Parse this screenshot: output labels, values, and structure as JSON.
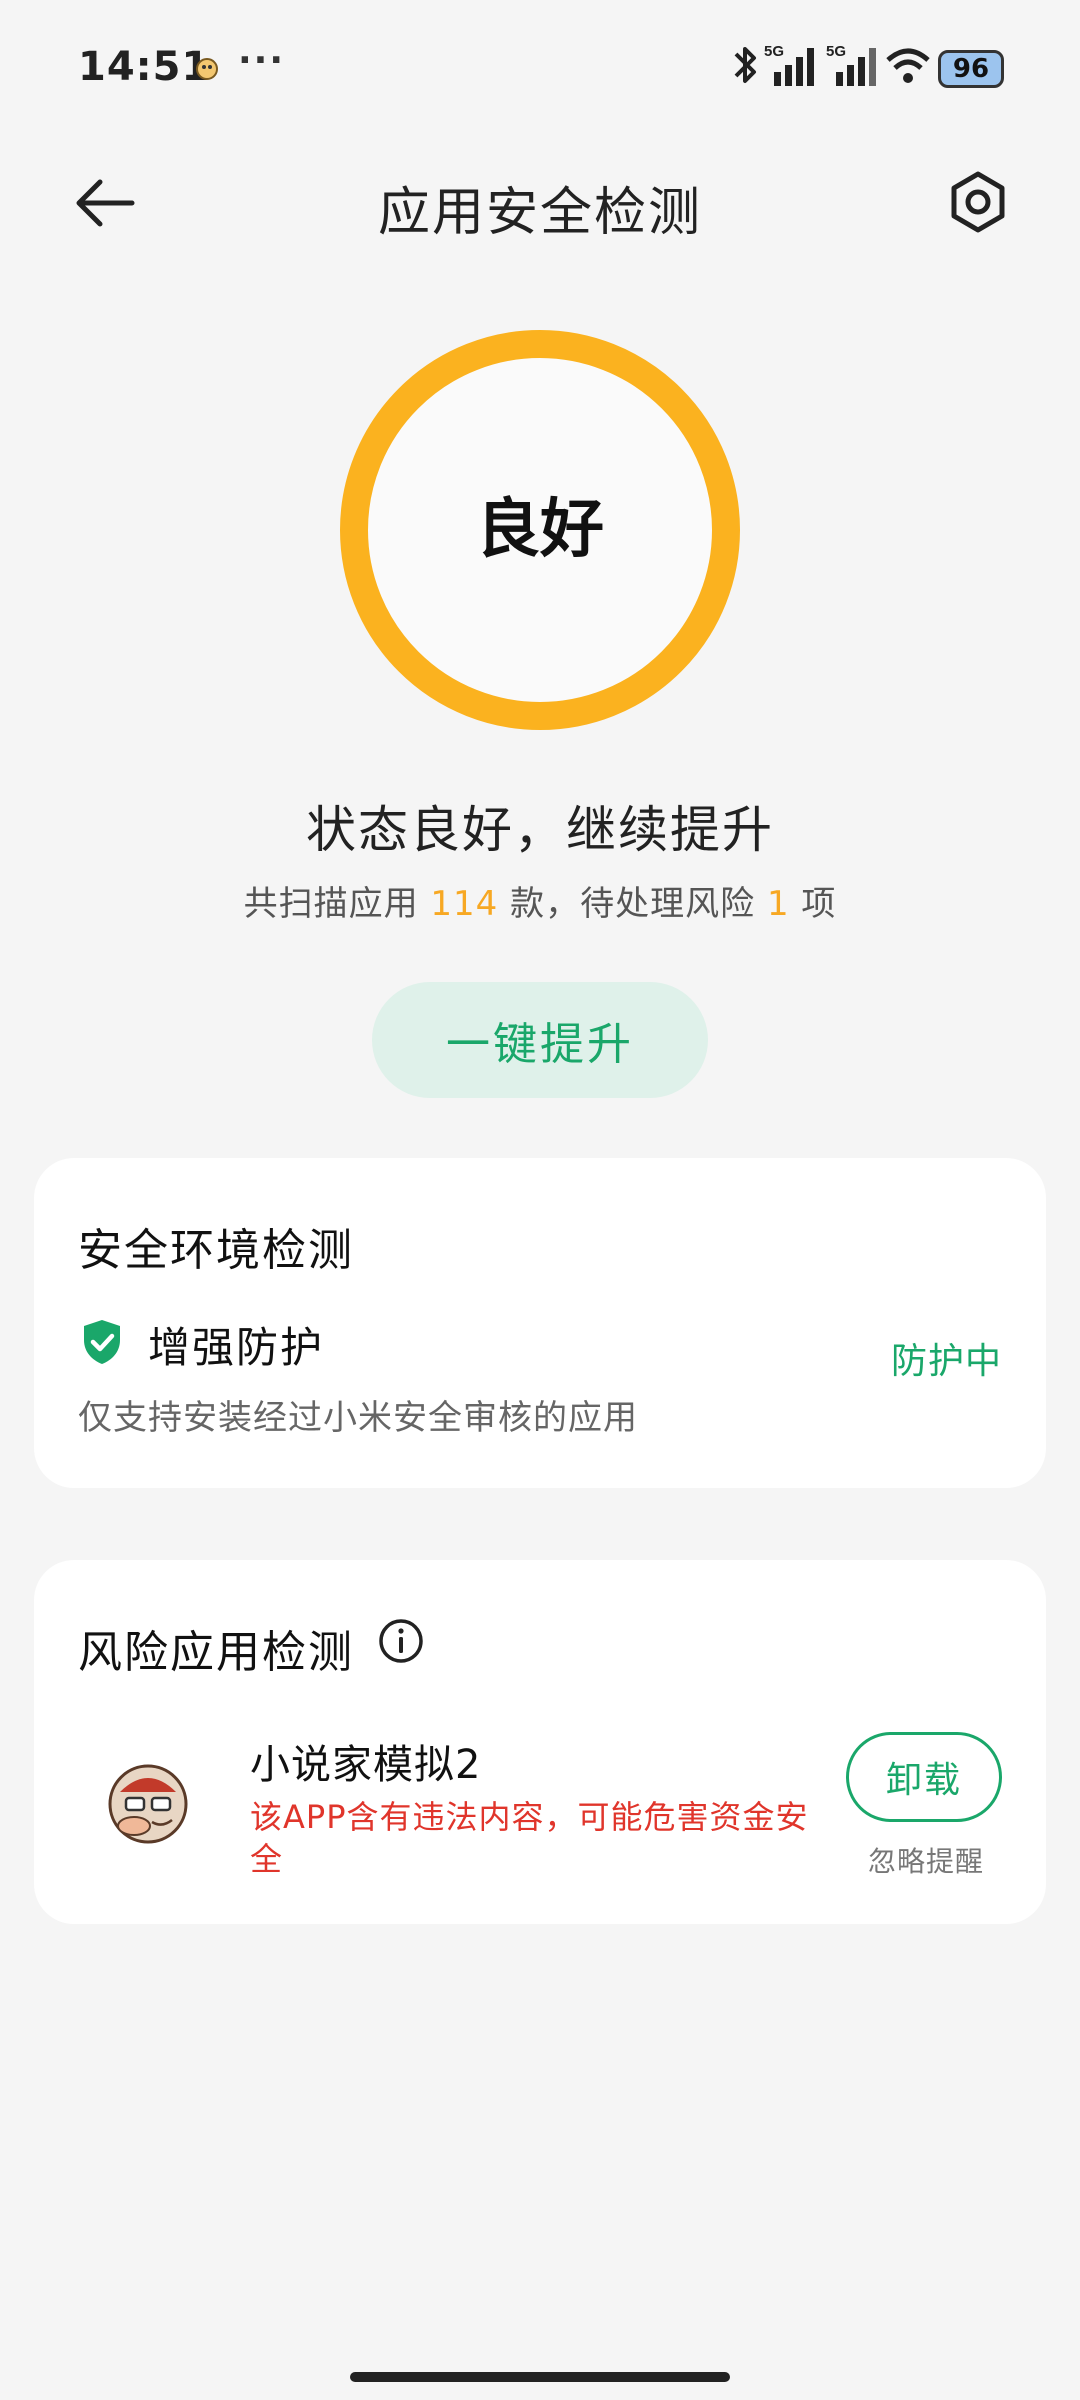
{
  "status_bar": {
    "time": "14:51",
    "more": "···",
    "network_1": "5G",
    "network_2": "5G",
    "battery": "96"
  },
  "header": {
    "title": "应用安全检测",
    "back_icon": "arrow-left-icon",
    "settings_icon": "gear-hex-icon"
  },
  "score": {
    "label": "良好",
    "ring_color": "#fbb21f"
  },
  "summary": {
    "heading": "状态良好，继续提升",
    "prefix": "共扫描应用 ",
    "apps_count": "114",
    "middle": " 款，待处理风险 ",
    "risk_count": "1",
    "suffix": " 项"
  },
  "boost_button": "一键提升",
  "env_card": {
    "title": "安全环境检测",
    "item_label": "增强防护",
    "item_desc": "仅支持安装经过小米安全审核的应用",
    "item_status": "防护中",
    "icon": "shield-check-icon"
  },
  "risk_card": {
    "title": "风险应用检测",
    "info_icon": "info-icon",
    "app": {
      "name": "小说家模拟2",
      "warning": "该APP含有违法内容，可能危害资金安全",
      "uninstall": "卸载",
      "ignore": "忽略提醒"
    }
  },
  "colors": {
    "accent_green": "#1aa76a",
    "warning_orange": "#f7a823",
    "danger_red": "#e0352b"
  }
}
